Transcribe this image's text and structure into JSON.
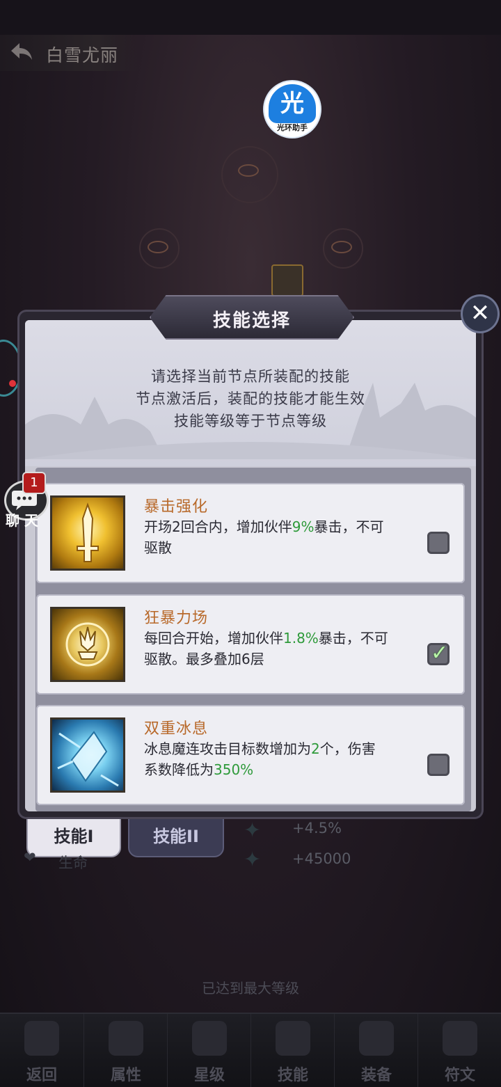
{
  "header": {
    "title": "白雪尤丽"
  },
  "logo": {
    "glyph": "光",
    "caption": "光环助手"
  },
  "dialog": {
    "title": "技能选择",
    "close_glyph": "✕",
    "description": [
      "请选择当前节点所装配的技能",
      "节点激活后，装配的技能才能生效",
      "技能等级等于节点等级"
    ]
  },
  "skills": [
    {
      "name": "暴击强化",
      "desc_a": "开场2回合内，增加伙伴",
      "desc_hl": "9%",
      "desc_b": "暴击，不可",
      "desc_c": "驱散",
      "selected": false
    },
    {
      "name": "狂暴力场",
      "desc_a": "每回合开始，增加伙伴",
      "desc_hl": "1.8%",
      "desc_b": "暴击，不可",
      "desc_c": "驱散。最多叠加6层",
      "selected": true
    },
    {
      "name": "双重冰息",
      "desc_a": "冰息魔连攻击目标数增加为",
      "desc_hl": "2",
      "desc_b": "个，伤害",
      "desc_c": "系数降低为",
      "desc_hl2": "350%",
      "selected": false
    }
  ],
  "check_glyph": "✓",
  "tabs": [
    {
      "label": "技能I",
      "active": true
    },
    {
      "label": "技能II",
      "active": false
    }
  ],
  "stats": [
    {
      "label": "",
      "value": "+4.5%"
    },
    {
      "label": "生命",
      "value": "+45000"
    }
  ],
  "chat": {
    "label": "聊 天",
    "badge": "1"
  },
  "max_level_text": "已达到最大等级",
  "bottom_nav": [
    "返回",
    "属性",
    "星级",
    "技能",
    "装备",
    "符文"
  ],
  "colors": {
    "skill_name": "#b8692a",
    "highlight": "#2e9a3a",
    "badge": "#b41c1c"
  }
}
